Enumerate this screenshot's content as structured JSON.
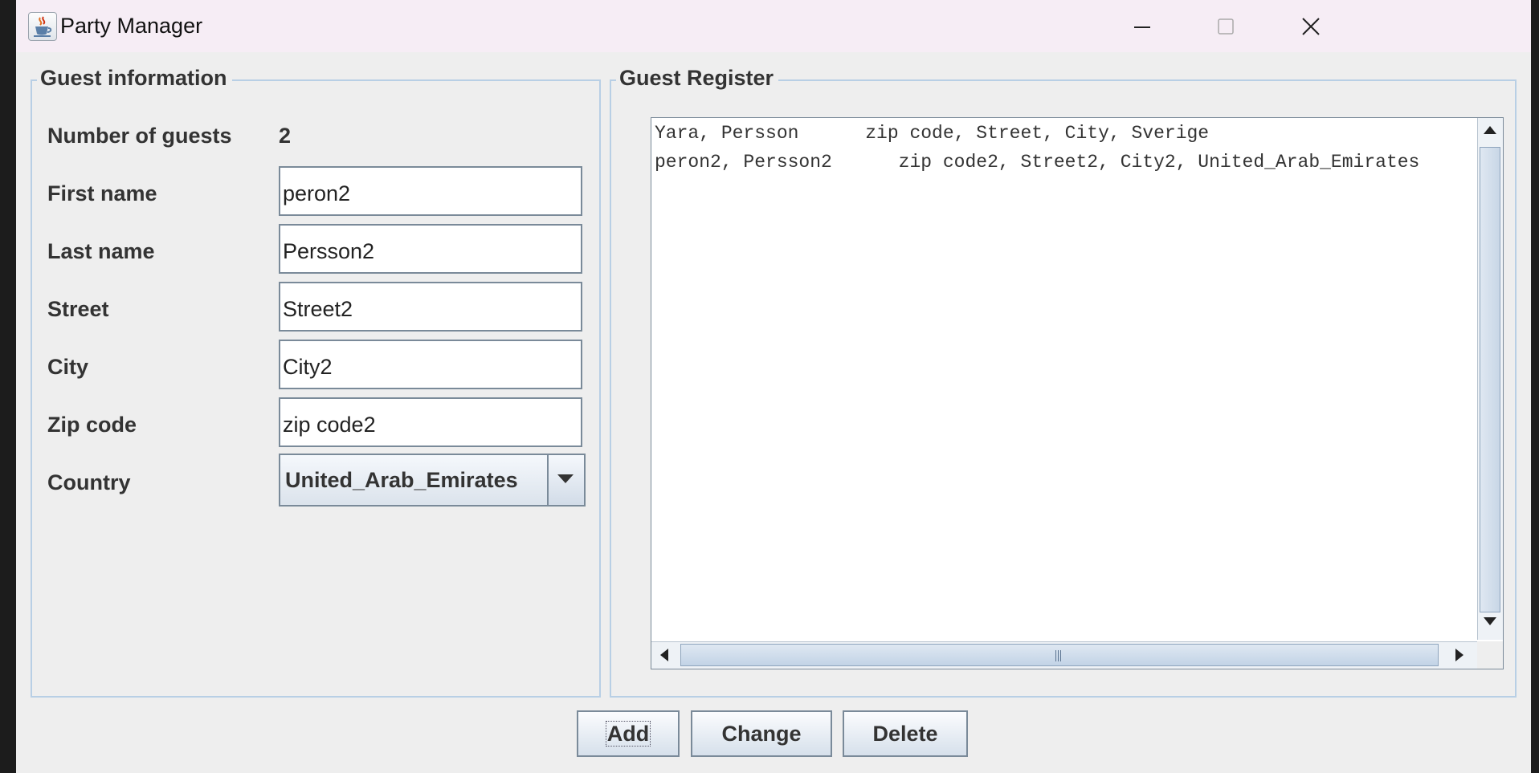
{
  "window": {
    "title": "Party Manager"
  },
  "guest_info": {
    "title": "Guest information",
    "count_label": "Number of guests",
    "count_value": "2",
    "fields": {
      "first_name": {
        "label": "First name",
        "value": "peron2"
      },
      "last_name": {
        "label": "Last name",
        "value": "Persson2"
      },
      "street": {
        "label": "Street",
        "value": "Street2"
      },
      "city": {
        "label": "City",
        "value": "City2"
      },
      "zip": {
        "label": "Zip code",
        "value": "zip code2"
      },
      "country": {
        "label": "Country",
        "value": "United_Arab_Emirates"
      }
    }
  },
  "register": {
    "title": "Guest Register",
    "lines": [
      "Yara, Persson      zip code, Street, City, Sverige",
      "peron2, Persson2      zip code2, Street2, City2, United_Arab_Emirates"
    ]
  },
  "buttons": {
    "add": "Add",
    "change": "Change",
    "delete": "Delete"
  },
  "icons": {
    "app": "java-cup-icon",
    "minimize": "minimize-icon",
    "maximize": "maximize-icon",
    "close": "close-icon",
    "dropdown": "chevron-down-icon"
  },
  "colors": {
    "group_border": "#b8cfe5",
    "titlebar": "#f6edf5",
    "panel": "#eeeeee"
  }
}
